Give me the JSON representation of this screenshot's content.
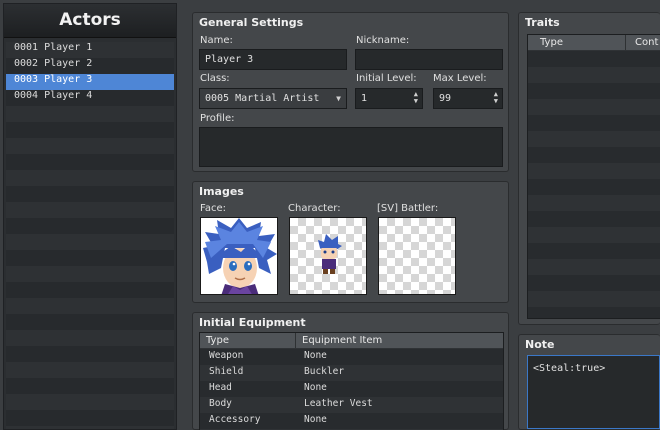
{
  "actors_panel": {
    "title": "Actors",
    "items": [
      {
        "label": "0001 Player 1"
      },
      {
        "label": "0002 Player 2"
      },
      {
        "label": "0003 Player 3",
        "selected": true
      },
      {
        "label": "0004 Player 4"
      }
    ]
  },
  "general": {
    "title": "General Settings",
    "name_label": "Name:",
    "name_value": "Player 3",
    "nickname_label": "Nickname:",
    "nickname_value": "",
    "class_label": "Class:",
    "class_value": "0005 Martial Artist",
    "initial_level_label": "Initial Level:",
    "initial_level_value": "1",
    "max_level_label": "Max Level:",
    "max_level_value": "99",
    "profile_label": "Profile:",
    "profile_value": ""
  },
  "images": {
    "title": "Images",
    "face_label": "Face:",
    "character_label": "Character:",
    "battler_label": "[SV] Battler:"
  },
  "equipment": {
    "title": "Initial Equipment",
    "columns": [
      "Type",
      "Equipment Item"
    ],
    "rows": [
      {
        "type": "Weapon",
        "item": "None"
      },
      {
        "type": "Shield",
        "item": "Buckler"
      },
      {
        "type": "Head",
        "item": "None"
      },
      {
        "type": "Body",
        "item": "Leather Vest"
      },
      {
        "type": "Accessory",
        "item": "None"
      }
    ]
  },
  "traits": {
    "title": "Traits",
    "columns": [
      "Type",
      "Cont"
    ]
  },
  "note": {
    "title": "Note",
    "value": "<Steal:true>"
  },
  "colors": {
    "selection": "#4e86d6",
    "panel": "#44474a",
    "field": "#26292b"
  }
}
